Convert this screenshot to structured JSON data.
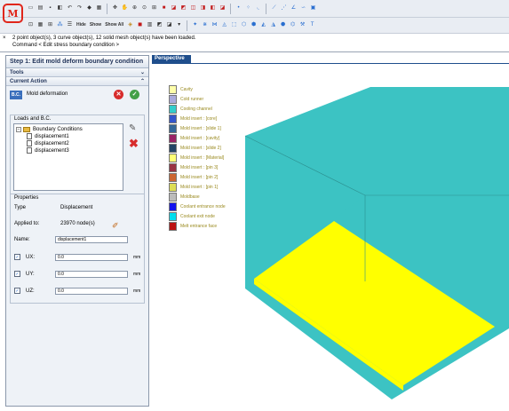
{
  "logo": {
    "letter": "M"
  },
  "console": {
    "close": "×",
    "lines": [
      "2 point object(s), 3 curve object(s), 12 solid mesh object(s) have been loaded.",
      "Command < Edit stress boundary condition >"
    ]
  },
  "toolbar": {
    "hide_label": "Hide",
    "show_label": "Show",
    "show_all_label": "Show All"
  },
  "panel": {
    "title": "Step 1: Edit mold deform boundary condition",
    "tools_label": "Tools",
    "current_action_label": "Current Action",
    "action_name": "Mold deformation",
    "action_icon_text": "B.C.",
    "loads_label": "Loads and B.C.",
    "tree": {
      "root": "Boundary Conditions",
      "children": [
        "displacement1",
        "displacement2",
        "displacement3"
      ]
    },
    "properties": {
      "label": "Properties",
      "type_label": "Type",
      "type_value": "Displacement",
      "applied_label": "Applied to:",
      "applied_value": "23970 node(s)",
      "name_label": "Name:",
      "name_value": "displacement1",
      "ux_label": "UX:",
      "ux_value": "0.0",
      "uy_label": "UY:",
      "uy_value": "0.0",
      "uz_label": "UZ:",
      "uz_value": "0.0",
      "unit": "mm"
    }
  },
  "viewport": {
    "tab": "Perspective",
    "legend": [
      {
        "label": "Cavity",
        "color": "#ffffaa"
      },
      {
        "label": "Cold runner",
        "color": "#aaaadd"
      },
      {
        "label": "Cooling channel",
        "color": "#33cccc"
      },
      {
        "label": "Mold insert : [core]",
        "color": "#3355cc"
      },
      {
        "label": "Mold insert : [slide 1]",
        "color": "#336699"
      },
      {
        "label": "Mold insert : [cavity]",
        "color": "#992266"
      },
      {
        "label": "Mold insert : [slide 2]",
        "color": "#224466"
      },
      {
        "label": "Mold insert : [Material]",
        "color": "#ffff77"
      },
      {
        "label": "Mold insert : [pin 3]",
        "color": "#993344"
      },
      {
        "label": "Mold insert : [pin 2]",
        "color": "#cc6633"
      },
      {
        "label": "Mold insert : [pin 1]",
        "color": "#dddd55"
      },
      {
        "label": "Moldbase",
        "color": "#bbbbbb"
      },
      {
        "label": "Coolant entrance node",
        "color": "#1111ee"
      },
      {
        "label": "Coolant exit node",
        "color": "#00ddee"
      },
      {
        "label": "Melt entrance face",
        "color": "#bb1111"
      }
    ],
    "model_colors": {
      "moldbase": "#3cc3c3",
      "part": "#ffff00"
    }
  }
}
